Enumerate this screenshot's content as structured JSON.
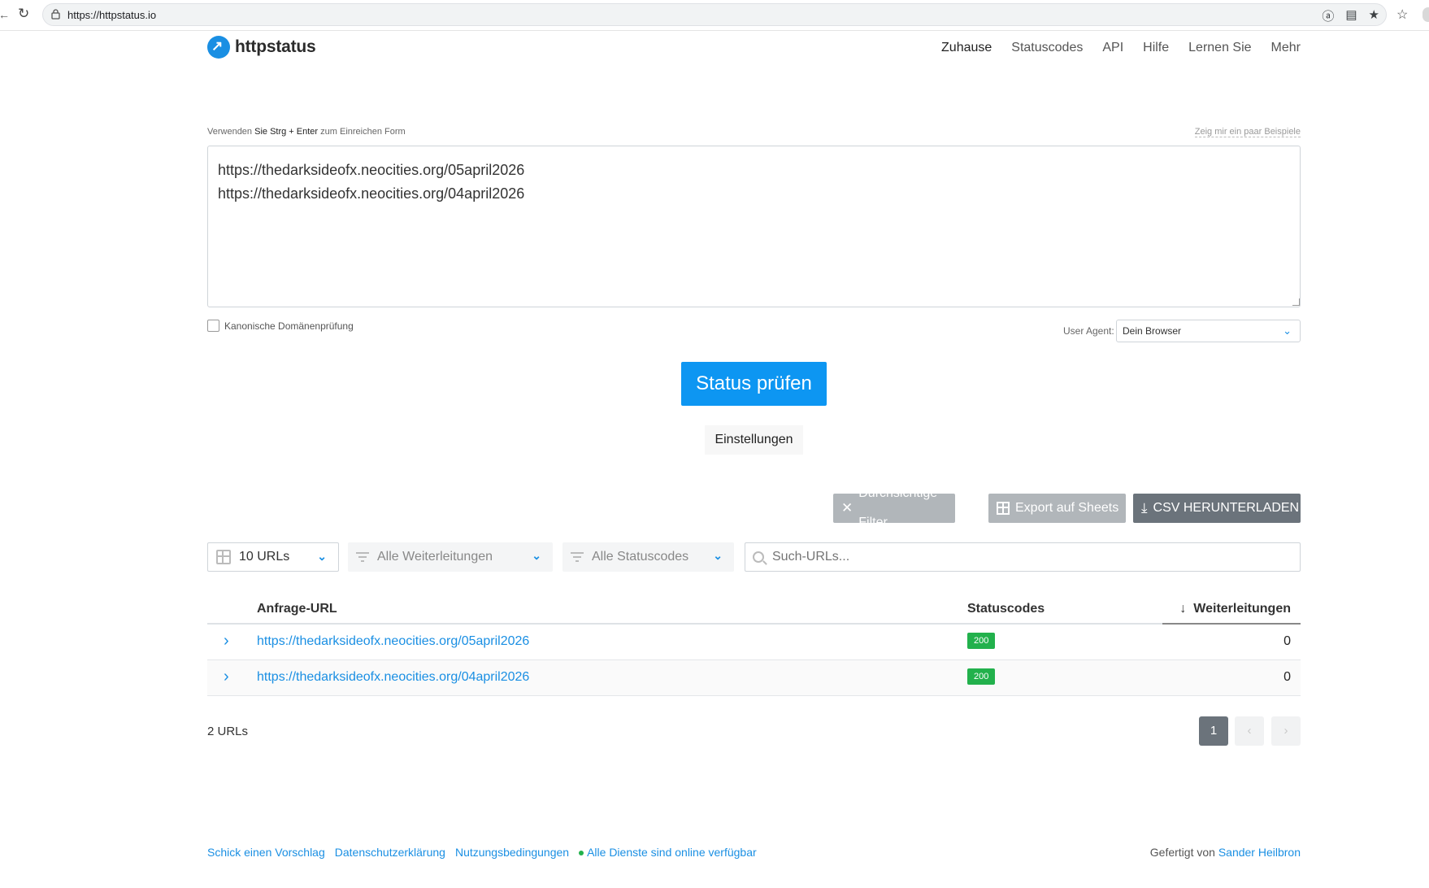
{
  "browser": {
    "url": "https://httpstatus.io"
  },
  "site": {
    "brand": "httpstatus",
    "nav": [
      "Zuhause",
      "Statuscodes",
      "API",
      "Hilfe",
      "Lernen Sie",
      "Mehr"
    ]
  },
  "form": {
    "hint_pre": "Verwenden",
    "hint_keys": "Sie Strg + Enter",
    "hint_post": "zum Einreichen Form",
    "examples_link": "Zeig mir ein paar Beispiele",
    "textarea_value": "https://thedarksideofx.neocities.org/05april2026\nhttps://thedarksideofx.neocities.org/04april2026",
    "canonical_label": "Kanonische Domänenprüfung",
    "ua_label": "User Agent:",
    "ua_value": "Dein Browser",
    "check_button": "Status prüfen",
    "settings_button": "Einstellungen"
  },
  "actions": {
    "clear_filter": "Durchsichtige Filter",
    "export_sheets": "Export auf Sheets",
    "csv_download": "CSV HERUNTERLADEN"
  },
  "filters": {
    "urls_count": "10 URLs",
    "redirects": "Alle Weiterleitungen",
    "status_codes": "Alle Statuscodes",
    "search_placeholder": "Such-URLs..."
  },
  "table": {
    "headers": {
      "url": "Anfrage-URL",
      "status": "Statuscodes",
      "redirects": "Weiterleitungen"
    },
    "rows": [
      {
        "url": "https://thedarksideofx.neocities.org/05april2026",
        "status": "200",
        "redirects": "0"
      },
      {
        "url": "https://thedarksideofx.neocities.org/04april2026",
        "status": "200",
        "redirects": "0"
      }
    ]
  },
  "summary": {
    "count": "2 URLs",
    "current_page": "1"
  },
  "footer": {
    "links": [
      "Schick einen Vorschlag",
      "Datenschutzerklärung",
      "Nutzungsbedingungen"
    ],
    "status": "Alle Dienste sind online verfügbar",
    "credit_pre": "Gefertigt von",
    "credit_name": "Sander Heilbron"
  },
  "colors": {
    "primary": "#0d96f2",
    "link": "#1a8fe3",
    "success": "#22b14c",
    "dark_button": "#6b737b"
  }
}
